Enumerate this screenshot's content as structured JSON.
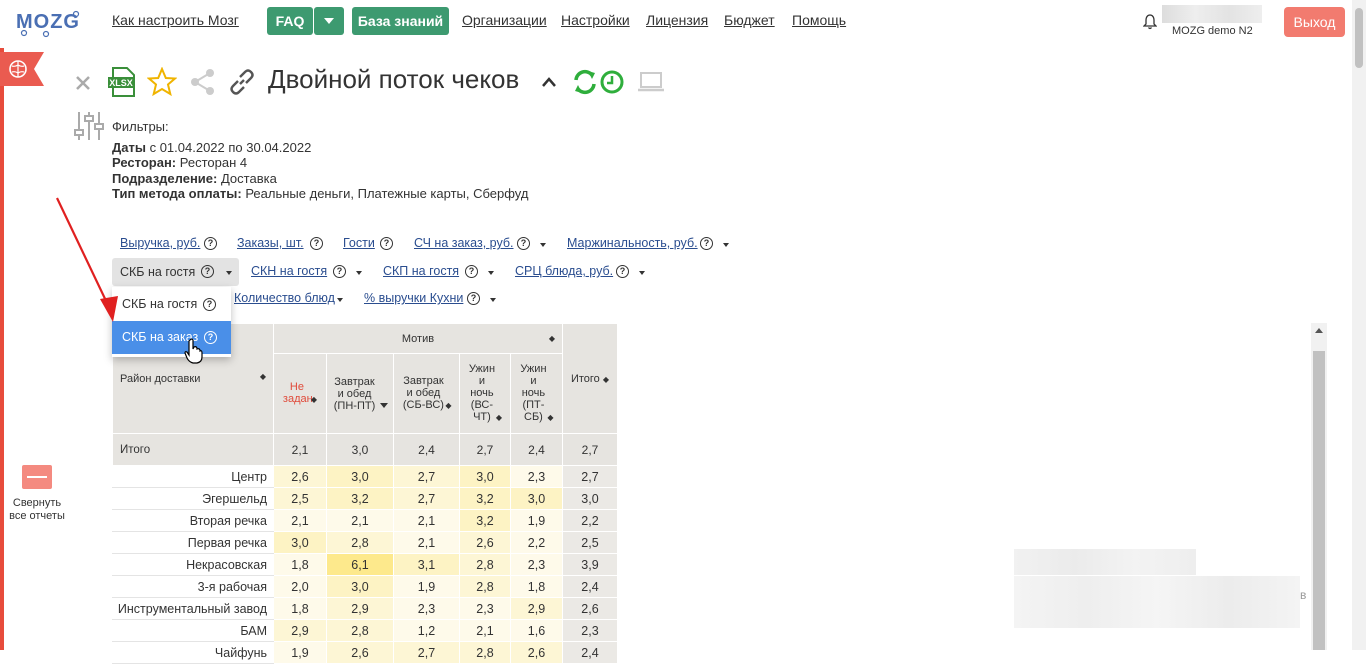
{
  "header": {
    "logo": "MOZG",
    "nav": [
      "Как настроить Мозг",
      "Организации",
      "Настройки",
      "Лицензия",
      "Бюджет",
      "Помощь"
    ],
    "faq": "FAQ",
    "knowledge": "База знаний",
    "user": "MOZG demo N2",
    "logout": "Выход"
  },
  "report": {
    "title": "Двойной поток чеков",
    "xlsx": "XLSX"
  },
  "filters": {
    "heading": "Фильтры:",
    "dates_label": "Даты",
    "dates_value": " с 01.04.2022 по 30.04.2022",
    "restaurant_label": "Ресторан:",
    "restaurant_value": " Ресторан 4",
    "division_label": "Подразделение:",
    "division_value": " Доставка",
    "payment_label": "Тип метода оплаты:",
    "payment_value": " Реальные деньги, Платежные карты, Сберфуд"
  },
  "metrics": {
    "row1": [
      "Выручка, руб.",
      "Заказы, шт.",
      "Гости",
      "СЧ на заказ, руб.",
      "Маржинальность, руб."
    ],
    "row2": [
      "СКБ на гостя",
      "СКН на гостя",
      "СКП на гостя",
      "СРЦ блюда, руб."
    ],
    "row3": [
      "Количество блюд",
      "% выручки Кухни"
    ],
    "q": "?"
  },
  "dropdown": {
    "items": [
      "СКБ на гостя",
      "СКБ на заказ"
    ]
  },
  "sidebar": {
    "collapse": "Свернуть все отчеты"
  },
  "table": {
    "group": "Мотив",
    "rowhead": "Район доставки",
    "columns": [
      "Не задан",
      "Завтрак и обед (ПН-ПТ)",
      "Завтрак и обед (СБ-ВС)",
      "Ужин и ночь (ВС-ЧТ)",
      "Ужин и ночь (ПТ-СБ)"
    ],
    "total_col": "Итого",
    "total_row": {
      "label": "Итого",
      "values": [
        "2,1",
        "3,0",
        "2,4",
        "2,7",
        "2,4",
        "2,7"
      ]
    },
    "rows": [
      {
        "label": "Центр",
        "values": [
          "2,6",
          "3,0",
          "2,7",
          "3,0",
          "2,3",
          "2,7"
        ]
      },
      {
        "label": "Эгершельд",
        "values": [
          "2,5",
          "3,2",
          "2,7",
          "3,2",
          "3,0",
          "3,0"
        ]
      },
      {
        "label": "Вторая речка",
        "values": [
          "2,1",
          "2,1",
          "2,1",
          "3,2",
          "1,9",
          "2,2"
        ]
      },
      {
        "label": "Первая речка",
        "values": [
          "3,0",
          "2,8",
          "2,1",
          "2,6",
          "2,2",
          "2,5"
        ]
      },
      {
        "label": "Некрасовская",
        "values": [
          "1,8",
          "6,1",
          "3,1",
          "2,8",
          "2,3",
          "3,9"
        ]
      },
      {
        "label": "3-я рабочая",
        "values": [
          "2,0",
          "3,0",
          "1,9",
          "2,8",
          "1,8",
          "2,4"
        ]
      },
      {
        "label": "Инструментальный завод",
        "values": [
          "1,8",
          "2,9",
          "2,3",
          "2,3",
          "2,9",
          "2,6"
        ]
      },
      {
        "label": "БАМ",
        "values": [
          "2,9",
          "2,8",
          "1,2",
          "2,1",
          "1,6",
          "2,3"
        ]
      },
      {
        "label": "Чайфунь",
        "values": [
          "1,9",
          "2,6",
          "2,7",
          "2,8",
          "2,6",
          "2,4"
        ]
      }
    ]
  },
  "misc": {
    "v": "в"
  }
}
